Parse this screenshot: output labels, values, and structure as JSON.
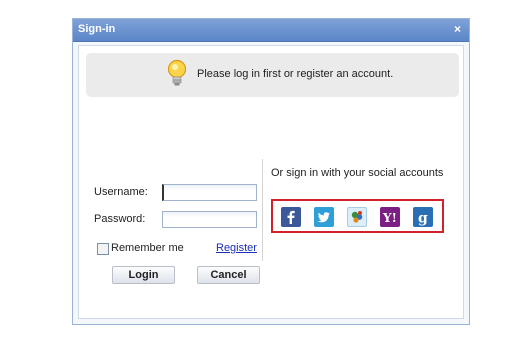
{
  "dialog": {
    "title": "Sign-in",
    "close_label": "×"
  },
  "notice": {
    "text": "Please log in first or register an account."
  },
  "form": {
    "username_label": "Username:",
    "password_label": "Password:",
    "username_value": "",
    "password_value": "",
    "remember_label": "Remember me",
    "register_label": "Register",
    "login_label": "Login",
    "cancel_label": "Cancel"
  },
  "social": {
    "heading": "Or sign in with your social accounts",
    "providers": [
      {
        "name": "facebook",
        "icon": "facebook-icon",
        "color": "#3b5998"
      },
      {
        "name": "twitter",
        "icon": "twitter-icon",
        "color": "#2f9fd8"
      },
      {
        "name": "windows-live",
        "icon": "windows-live-icon",
        "color": "#cde6f7"
      },
      {
        "name": "yahoo",
        "icon": "yahoo-icon",
        "color": "#7b1f82"
      },
      {
        "name": "google",
        "icon": "google-icon",
        "color": "#2a6fb6"
      }
    ],
    "highlight_color": "#d4202a"
  }
}
